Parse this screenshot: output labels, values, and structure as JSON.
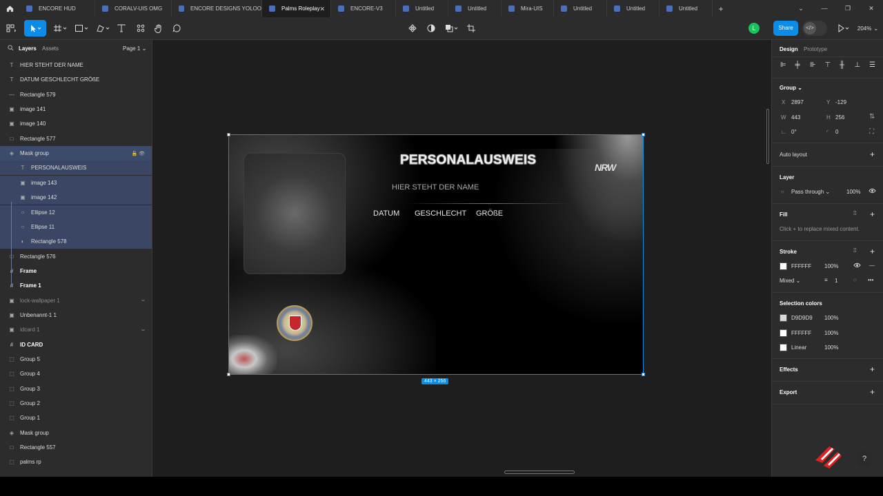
{
  "tabs": [
    {
      "label": "ENCORE HUD",
      "active": false
    },
    {
      "label": "CORALV-UIS OMG",
      "active": false
    },
    {
      "label": "ENCORE DESIGNS YOLOO",
      "active": false
    },
    {
      "label": "Palms Roleplay",
      "active": true
    },
    {
      "label": "ENCORE-V3",
      "active": false
    },
    {
      "label": "Untitled",
      "active": false
    },
    {
      "label": "Untitled",
      "active": false
    },
    {
      "label": "Mira-UIS",
      "active": false
    },
    {
      "label": "Untitled",
      "active": false
    },
    {
      "label": "Untitled",
      "active": false
    },
    {
      "label": "Untitled",
      "active": false
    }
  ],
  "toolbar": {
    "share_label": "Share",
    "zoom": "204%",
    "avatar_initial": "L"
  },
  "left_panel": {
    "layers_tab": "Layers",
    "assets_tab": "Assets",
    "page": "Page 1",
    "layers": [
      {
        "name": "HIER STEHT DER NAME",
        "icon": "text-icon"
      },
      {
        "name": "DATUM GESCHLECHT GRÖßE",
        "icon": "text-icon"
      },
      {
        "name": "Rectangle 579",
        "icon": "line-icon"
      },
      {
        "name": "image 141",
        "icon": "image-icon"
      },
      {
        "name": "image 140",
        "icon": "image-icon"
      },
      {
        "name": "Rectangle 577",
        "icon": "rectangle-icon"
      },
      {
        "name": "Mask group",
        "icon": "mask-icon"
      },
      {
        "name": "PERSONALAUSWEIS",
        "icon": "text-icon"
      },
      {
        "name": "image 143",
        "icon": "image-icon"
      },
      {
        "name": "image 142",
        "icon": "image-icon"
      },
      {
        "name": "Ellipse 12",
        "icon": "ellipse-icon"
      },
      {
        "name": "Ellipse 11",
        "icon": "ellipse-icon"
      },
      {
        "name": "Rectangle 578",
        "icon": "mask-shape-icon"
      },
      {
        "name": "Rectangle 576",
        "icon": "rectangle-icon"
      },
      {
        "name": "Frame",
        "icon": "frame-icon"
      },
      {
        "name": "Frame 1",
        "icon": "frame-icon"
      },
      {
        "name": "lock-wallpaper 1",
        "icon": "image-icon"
      },
      {
        "name": "Unbenannt-1 1",
        "icon": "image-icon"
      },
      {
        "name": "idcard 1",
        "icon": "image-icon"
      },
      {
        "name": "ID CARD",
        "icon": "frame-icon"
      },
      {
        "name": "Group 5",
        "icon": "group-icon"
      },
      {
        "name": "Group 4",
        "icon": "group-icon"
      },
      {
        "name": "Group 3",
        "icon": "group-icon"
      },
      {
        "name": "Group 2",
        "icon": "group-icon"
      },
      {
        "name": "Group 1",
        "icon": "group-icon"
      },
      {
        "name": "Mask group",
        "icon": "mask-icon"
      },
      {
        "name": "Rectangle 557",
        "icon": "rectangle-icon"
      },
      {
        "name": "palms rp",
        "icon": "group-icon"
      }
    ]
  },
  "card": {
    "title": "PERSONALAUSWEIS",
    "name_placeholder": "HIER STEHT DER NAME",
    "field_datum": "DATUM",
    "field_geschlecht": "GESCHLECHT",
    "field_groesse": "GRÖßE",
    "logo_text": "NRW",
    "size_label": "443 × 256"
  },
  "right_panel": {
    "tab_design": "Design",
    "tab_prototype": "Prototype",
    "group_label": "Group",
    "x_label": "X",
    "x_value": "2897",
    "y_label": "Y",
    "y_value": "-129",
    "w_label": "W",
    "w_value": "443",
    "h_label": "H",
    "h_value": "256",
    "rotation": "0°",
    "radius": "0",
    "auto_layout": "Auto layout",
    "layer_label": "Layer",
    "blend_mode": "Pass through",
    "layer_opacity": "100%",
    "fill_label": "Fill",
    "fill_hint": "Click + to replace mixed content.",
    "stroke_label": "Stroke",
    "stroke_color": "FFFFFF",
    "stroke_opacity": "100%",
    "stroke_position": "Mixed",
    "stroke_weight": "1",
    "selection_colors_label": "Selection colors",
    "selection_colors": [
      {
        "value": "D9D9D9",
        "opacity": "100%",
        "hex": "#D9D9D9"
      },
      {
        "value": "FFFFFF",
        "opacity": "100%",
        "hex": "#FFFFFF"
      },
      {
        "value": "Linear",
        "opacity": "100%",
        "hex": "#FFFFFF"
      }
    ],
    "effects_label": "Effects",
    "export_label": "Export"
  },
  "colors": {
    "accent": "#0C8CE9",
    "panel": "#2C2C2C",
    "canvas": "#1E1E1E"
  }
}
